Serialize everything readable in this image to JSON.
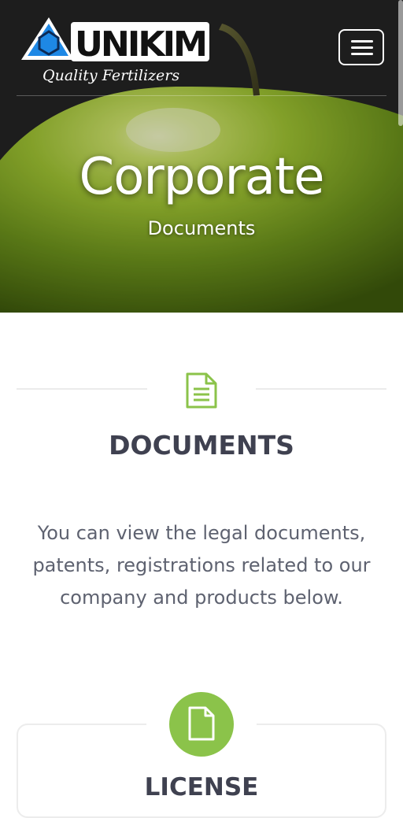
{
  "brand": {
    "name": "UNIKIM",
    "tagline": "Quality Fertilizers"
  },
  "header": {
    "menu_icon": "hamburger-menu-icon"
  },
  "hero": {
    "title": "Corporate",
    "subtitle": "Documents"
  },
  "section": {
    "icon": "document-icon",
    "title": "DOCUMENTS",
    "description": "You can view the legal documents, patents, registrations related to our company and products below."
  },
  "cards": [
    {
      "icon": "file-icon",
      "title": "LICENSE"
    }
  ],
  "colors": {
    "accent": "#8bc34a",
    "heading": "#3f4150",
    "body_text": "#5e6270",
    "logo_blue": "#1e88e5"
  }
}
